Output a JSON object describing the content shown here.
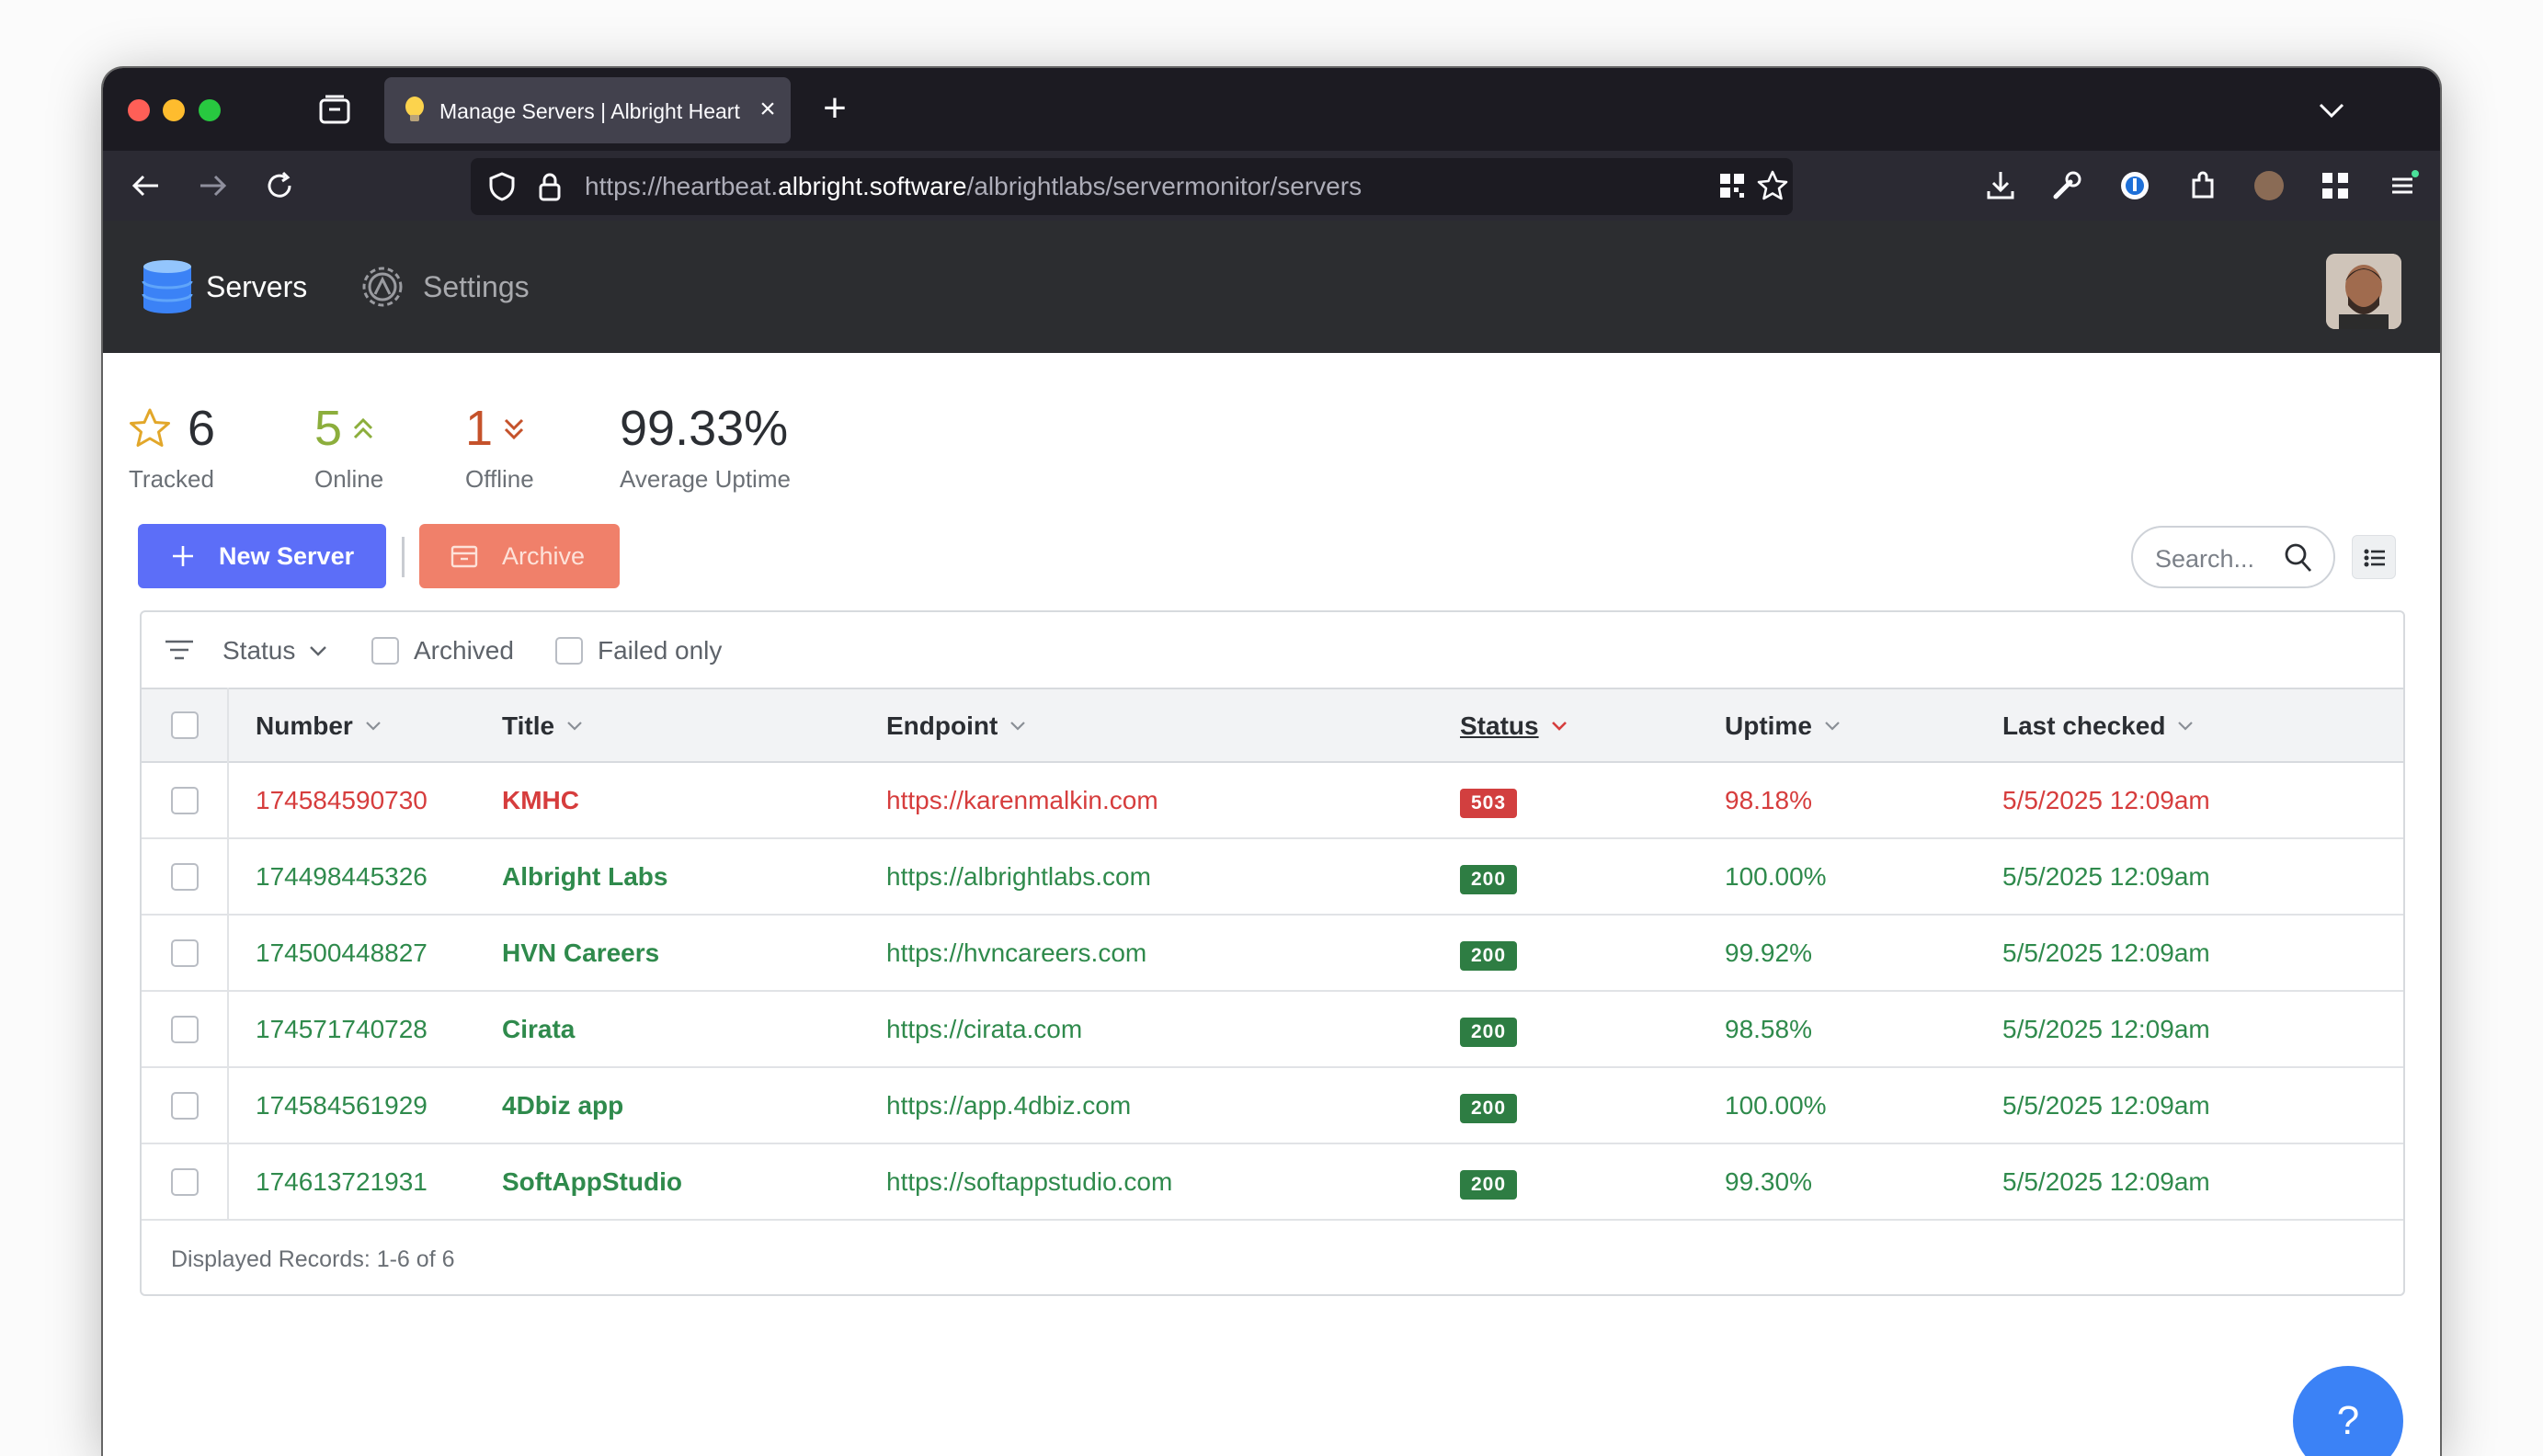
{
  "browser": {
    "tab_title": "Manage Servers | Albright Heart",
    "url_prefix": "https://heartbeat.",
    "url_host": "albright.software",
    "url_path": "/albrightlabs/servermonitor/servers"
  },
  "app": {
    "nav": [
      {
        "label": "Servers",
        "active": true
      },
      {
        "label": "Settings",
        "active": false
      }
    ]
  },
  "stats": {
    "tracked": {
      "value": "6",
      "label": "Tracked"
    },
    "online": {
      "value": "5",
      "label": "Online"
    },
    "offline": {
      "value": "1",
      "label": "Offline"
    },
    "uptime": {
      "value": "99.33%",
      "label": "Average Uptime"
    }
  },
  "toolbar": {
    "new_label": "New Server",
    "archive_label": "Archive",
    "search_placeholder": "Search..."
  },
  "filters": {
    "status_label": "Status",
    "archived_label": "Archived",
    "failed_label": "Failed only"
  },
  "table": {
    "columns": [
      "Number",
      "Title",
      "Endpoint",
      "Status",
      "Uptime",
      "Last checked"
    ],
    "rows": [
      {
        "number": "174584590730",
        "title": "KMHC",
        "endpoint": "https://karenmalkin.com",
        "status": "503",
        "uptime": "98.18%",
        "checked": "5/5/2025 12:09am",
        "state": "failed"
      },
      {
        "number": "174498445326",
        "title": "Albright Labs",
        "endpoint": "https://albrightlabs.com",
        "status": "200",
        "uptime": "100.00%",
        "checked": "5/5/2025 12:09am",
        "state": "ok"
      },
      {
        "number": "174500448827",
        "title": "HVN Careers",
        "endpoint": "https://hvncareers.com",
        "status": "200",
        "uptime": "99.92%",
        "checked": "5/5/2025 12:09am",
        "state": "ok"
      },
      {
        "number": "174571740728",
        "title": "Cirata",
        "endpoint": "https://cirata.com",
        "status": "200",
        "uptime": "98.58%",
        "checked": "5/5/2025 12:09am",
        "state": "ok"
      },
      {
        "number": "174584561929",
        "title": "4Dbiz app",
        "endpoint": "https://app.4dbiz.com",
        "status": "200",
        "uptime": "100.00%",
        "checked": "5/5/2025 12:09am",
        "state": "ok"
      },
      {
        "number": "174613721931",
        "title": "SoftAppStudio",
        "endpoint": "https://softappstudio.com",
        "status": "200",
        "uptime": "99.30%",
        "checked": "5/5/2025 12:09am",
        "state": "ok"
      }
    ],
    "footer": "Displayed Records: 1-6 of 6"
  },
  "help_label": "?",
  "colors": {
    "failed": "#d63d3d",
    "ok": "#2f8a4c",
    "badge_failed": "#d23f3f",
    "badge_ok": "#2e7d43",
    "online": "#8cae3c",
    "offline": "#c5522b",
    "primary": "#5c6ef8",
    "danger_light": "#f0806a"
  }
}
